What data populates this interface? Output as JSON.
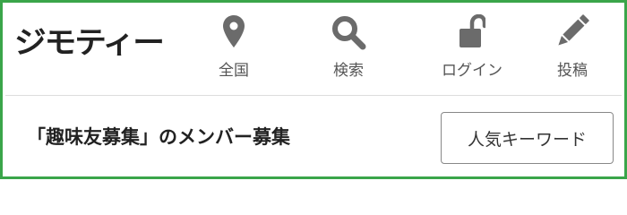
{
  "header": {
    "logo_text": "ジモティー",
    "nav": [
      {
        "label": "全国",
        "icon": "map-pin-icon"
      },
      {
        "label": "検索",
        "icon": "search-icon"
      },
      {
        "label": "ログイン",
        "icon": "unlock-icon"
      },
      {
        "label": "投稿",
        "icon": "pencil-icon"
      }
    ]
  },
  "main": {
    "title": "「趣味友募集」のメンバー募集",
    "keyword_button": "人気キーワード"
  },
  "colors": {
    "border_accent": "#3aa54a",
    "icon_gray": "#6b6b6b",
    "text_dark": "#222222"
  }
}
